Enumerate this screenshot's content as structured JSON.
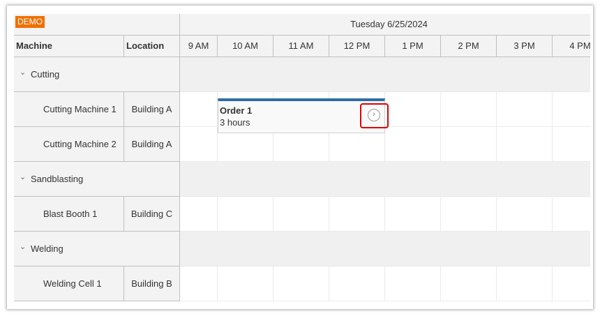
{
  "badge": "DEMO",
  "columns": {
    "machine": "Machine",
    "location": "Location"
  },
  "day_header": "Tuesday 6/25/2024",
  "hours": [
    "9 AM",
    "10 AM",
    "11 AM",
    "12 PM",
    "1 PM",
    "2 PM",
    "3 PM",
    "4 PM"
  ],
  "rows": [
    {
      "type": "group",
      "name": "Cutting"
    },
    {
      "type": "resource",
      "name": "Cutting Machine 1",
      "location": "Building A"
    },
    {
      "type": "resource",
      "name": "Cutting Machine 2",
      "location": "Building A"
    },
    {
      "type": "group",
      "name": "Sandblasting"
    },
    {
      "type": "resource",
      "name": "Blast Booth 1",
      "location": "Building C"
    },
    {
      "type": "group",
      "name": "Welding"
    },
    {
      "type": "resource",
      "name": "Welding Cell 1",
      "location": "Building B"
    }
  ],
  "event": {
    "title": "Order 1",
    "duration": "3 hours",
    "bar_color": "#2e6da4"
  },
  "colors": {
    "badge": "#f07000",
    "highlight": "#e00000"
  },
  "icons": {
    "group_toggle": "chevron-down-icon",
    "event_action": "chevron-right-circle-icon"
  }
}
